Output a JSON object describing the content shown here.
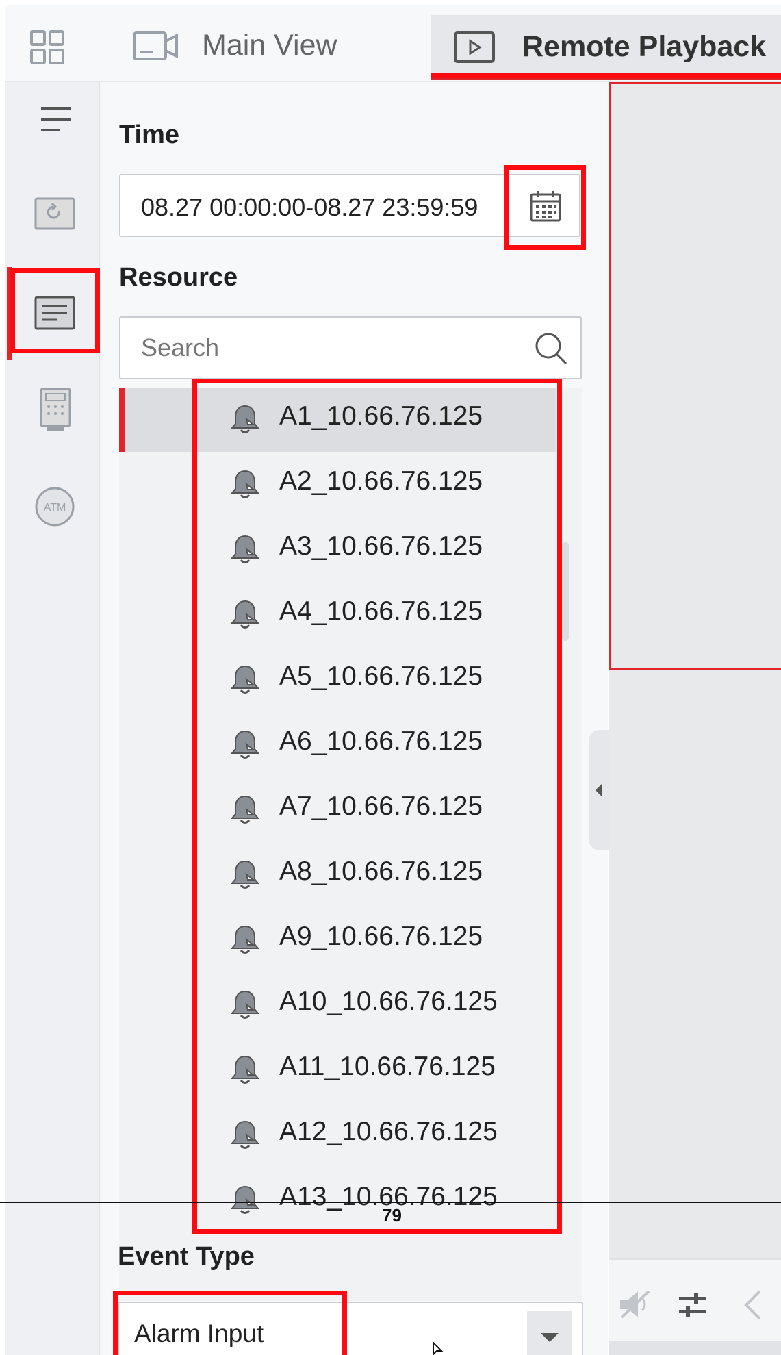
{
  "tabs": {
    "main_view": "Main View",
    "remote_playback": "Remote Playback"
  },
  "panel": {
    "time_title": "Time",
    "time_value": "08.27 00:00:00-08.27 23:59:59",
    "resource_title": "Resource",
    "search_placeholder": "Search",
    "resources": [
      "A1_10.66.76.125",
      "A2_10.66.76.125",
      "A3_10.66.76.125",
      "A4_10.66.76.125",
      "A5_10.66.76.125",
      "A6_10.66.76.125",
      "A7_10.66.76.125",
      "A8_10.66.76.125",
      "A9_10.66.76.125",
      "A10_10.66.76.125",
      "A11_10.66.76.125",
      "A12_10.66.76.125",
      "A13_10.66.76.125"
    ],
    "event_type_title": "Event Type",
    "event_type_value": "Alarm Input"
  },
  "page_number": "79",
  "icons": {
    "grid": "grid-icon",
    "camera": "camera-icon",
    "playback": "playback-icon",
    "menu": "menu-icon",
    "bell": "alarm-bell-icon",
    "calendar": "calendar-icon",
    "search": "search-icon"
  },
  "colors": {
    "accent_red": "#e0252b",
    "highlight_red": "#ff0a10",
    "panel_bg": "#f7f8fa"
  }
}
